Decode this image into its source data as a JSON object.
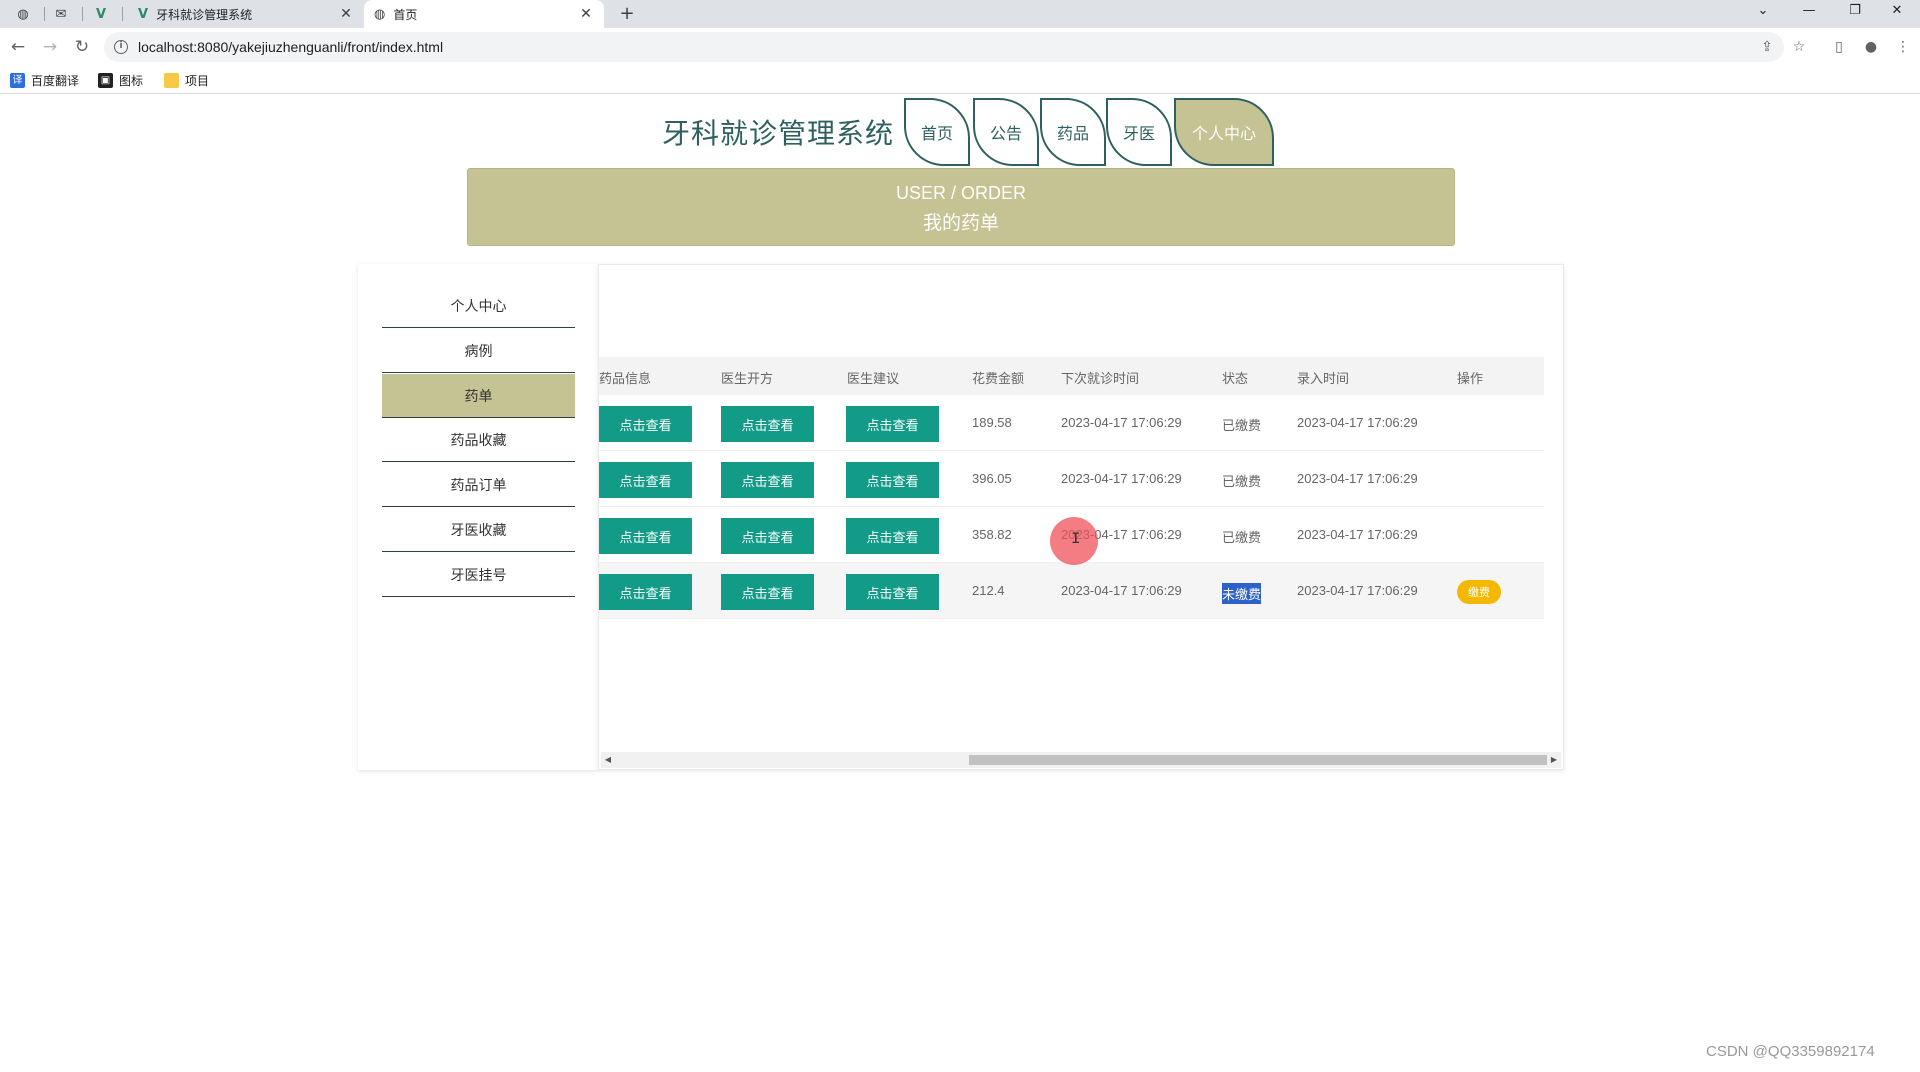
{
  "browser": {
    "tabs": [
      {
        "title": "牙科就诊管理系统",
        "close": "✕"
      },
      {
        "title": "首页",
        "close": "✕"
      }
    ],
    "new_tab": "+",
    "url": "localhost:8080/yakejiuzhenguanli/front/index.html",
    "bookmarks": [
      "百度翻译",
      "图标",
      "项目"
    ],
    "controls": {
      "minimize": "—",
      "restore": "❐",
      "close": "✕",
      "dropdown": "⌄"
    }
  },
  "site": {
    "title": "牙科就诊管理系统",
    "nav": [
      "首页",
      "公告",
      "药品",
      "牙医",
      "个人中心"
    ],
    "active_nav": "个人中心",
    "accent_color": "#c5c293",
    "primary_color": "#2e6060"
  },
  "banner": {
    "en": "USER / ORDER",
    "cn": "我的药单"
  },
  "sidebar": {
    "items": [
      "个人中心",
      "病例",
      "药单",
      "药品收藏",
      "药品订单",
      "牙医收藏",
      "牙医挂号"
    ],
    "active": "药单"
  },
  "table": {
    "headers": [
      "药品信息",
      "医生开方",
      "医生建议",
      "花费金额",
      "下次就诊时间",
      "状态",
      "录入时间",
      "操作"
    ],
    "view_label": "点击查看",
    "pay_label": "缴费",
    "button_color": "#129b86",
    "pay_color": "#f5b800",
    "rows": [
      {
        "amount": "189.58",
        "next_visit": "2023-04-17 17:06:29",
        "status": "已缴费",
        "created": "2023-04-17 17:06:29",
        "action": ""
      },
      {
        "amount": "396.05",
        "next_visit": "2023-04-17 17:06:29",
        "status": "已缴费",
        "created": "2023-04-17 17:06:29",
        "action": ""
      },
      {
        "amount": "358.82",
        "next_visit": "2023-04-17 17:06:29",
        "status": "已缴费",
        "created": "2023-04-17 17:06:29",
        "action": ""
      },
      {
        "amount": "212.4",
        "next_visit": "2023-04-17 17:06:29",
        "status": "未缴费",
        "created": "2023-04-17 17:06:29",
        "action": "缴费"
      }
    ]
  },
  "watermark": "CSDN @QQ3359892174"
}
